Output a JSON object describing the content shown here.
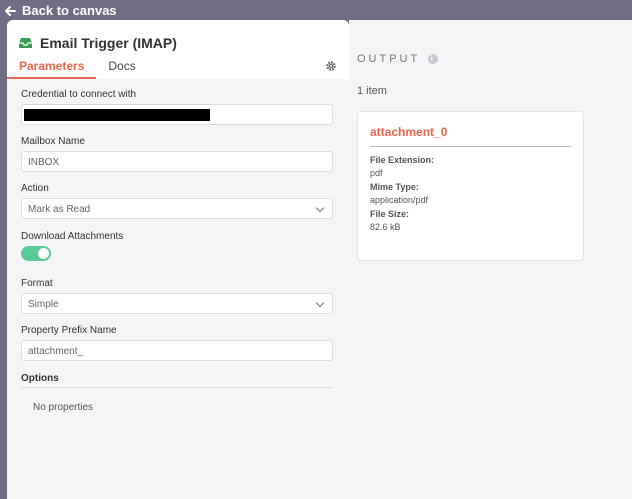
{
  "topbar": {
    "back_label": "Back to canvas"
  },
  "node": {
    "title": "Email Trigger (IMAP)",
    "tabs": [
      "Parameters",
      "Docs"
    ],
    "active_tab": "Parameters"
  },
  "params": {
    "credential_label": "Credential to connect with",
    "mailbox_label": "Mailbox Name",
    "mailbox_value": "INBOX",
    "action_label": "Action",
    "action_value": "Mark as Read",
    "download_label": "Download Attachments",
    "download_on": true,
    "format_label": "Format",
    "format_value": "Simple",
    "prefix_label": "Property Prefix Name",
    "prefix_value": "attachment_",
    "options_label": "Options",
    "no_properties": "No properties"
  },
  "output": {
    "title": "OUTPUT",
    "item_count": "1 item",
    "card": {
      "title": "attachment_0",
      "ext_key": "File Extension:",
      "ext_value": "pdf",
      "mime_key": "Mime Type:",
      "mime_value": "application/pdf",
      "size_key": "File Size:",
      "size_value": "82.6 kB"
    }
  },
  "colors": {
    "accent": "#e8674d",
    "toggle_on": "#5ac998",
    "backdrop": "#6e6d84"
  }
}
